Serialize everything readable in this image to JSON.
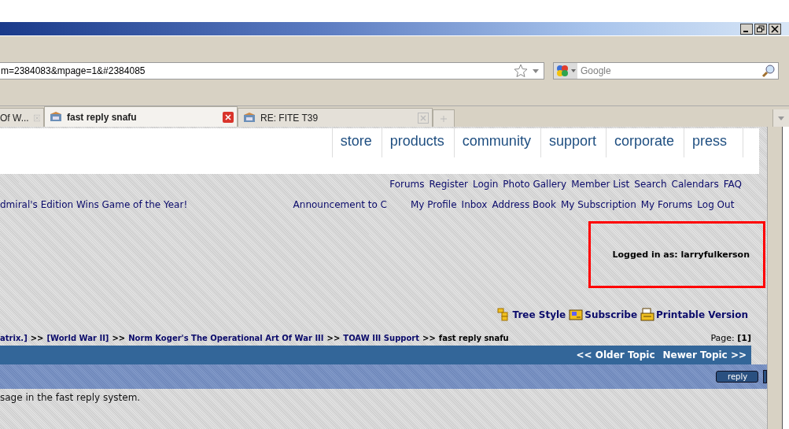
{
  "address_bar": {
    "value": "m=2384083&mpage=1&#2384085"
  },
  "search_box": {
    "placeholder": "Google"
  },
  "tabs": [
    {
      "label": "Of W...",
      "selected": false
    },
    {
      "label": "fast reply snafu",
      "selected": true
    },
    {
      "label": "RE: FITE T39",
      "selected": false
    }
  ],
  "site_nav": [
    "store",
    "products",
    "community",
    "support",
    "corporate",
    "press"
  ],
  "forum_links": [
    "Forums",
    "Register",
    "Login",
    "Photo Gallery",
    "Member List",
    "Search",
    "Calendars",
    "FAQ"
  ],
  "headlines": [
    "dmiral's Edition Wins Game of the Year!",
    "Announcement to C"
  ],
  "user_links": [
    "My Profile",
    "Inbox",
    "Address Book",
    "My Subscription",
    "My Forums",
    "Log Out"
  ],
  "login_status": "Logged in as: larryfulkerson",
  "tools": [
    {
      "kind": "tree",
      "label": "Tree Style"
    },
    {
      "kind": "subscribe",
      "label": "Subscribe"
    },
    {
      "kind": "print",
      "label": "Printable Version"
    }
  ],
  "breadcrumb": [
    {
      "text": "atrix.]",
      "current": false
    },
    {
      "text": "[World War II]",
      "current": false
    },
    {
      "text": "Norm Koger's The Operational Art Of War III",
      "current": false
    },
    {
      "text": "TOAW III Support",
      "current": false
    },
    {
      "text": "fast reply snafu",
      "current": true
    }
  ],
  "breadcrumb_separator": ">>",
  "pages": {
    "label": "Page:",
    "current": "[1]"
  },
  "topic_nav": [
    "<< Older Topic",
    "Newer Topic >>"
  ],
  "reply_button": "reply",
  "message": "sage in the fast reply system."
}
